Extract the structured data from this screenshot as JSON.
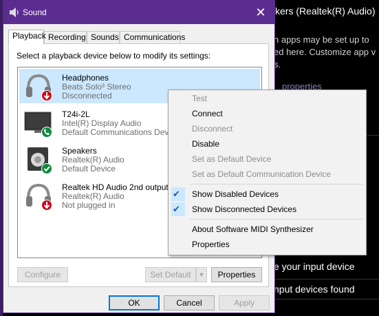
{
  "background_window": {
    "title": "kers (Realtek(R) Audio)",
    "text_lines": [
      "n apps may be set up to",
      "ed here. Customize app v",
      "s."
    ],
    "link": "properties",
    "input_device_text": "e your input device",
    "no_input_text": "nput devices found",
    "bottom_text": "..."
  },
  "dialog": {
    "title": "Sound",
    "close_label": "✕",
    "tabs": [
      "Playback",
      "Recording",
      "Sounds",
      "Communications"
    ],
    "instruction": "Select a playback device below to modify its settings:",
    "devices": [
      {
        "name": "Headphones",
        "line1": "Beats Solo³ Stereo",
        "line2": "Disconnected",
        "status": "disconnected",
        "icon": "headphones-icon"
      },
      {
        "name": "T24i-2L",
        "line1": "Intel(R) Display Audio",
        "line2": "Default Communications Device",
        "status": "default-communications",
        "icon": "monitor-icon"
      },
      {
        "name": "Speakers",
        "line1": "Realtek(R) Audio",
        "line2": "Default Device",
        "status": "default",
        "icon": "speaker-icon"
      },
      {
        "name": "Realtek HD Audio 2nd output",
        "line1": "Realtek(R) Audio",
        "line2": "Not plugged in",
        "status": "not-plugged-in",
        "icon": "headphones-icon"
      }
    ],
    "buttons": {
      "configure": "Configure",
      "set_default": "Set Default",
      "properties": "Properties",
      "ok": "OK",
      "cancel": "Cancel",
      "apply": "Apply"
    }
  },
  "context_menu": {
    "items": [
      {
        "label": "Test",
        "enabled": false
      },
      {
        "label": "Connect",
        "enabled": true
      },
      {
        "label": "Disconnect",
        "enabled": false
      },
      {
        "label": "Disable",
        "enabled": true
      },
      {
        "label": "Set as Default Device",
        "enabled": false
      },
      {
        "label": "Set as Default Communication Device",
        "enabled": false
      },
      {
        "label": "Show Disabled Devices",
        "enabled": true,
        "checked": true
      },
      {
        "label": "Show Disconnected Devices",
        "enabled": true,
        "checked": true
      },
      {
        "label": "About Software MIDI Synthesizer",
        "enabled": true
      },
      {
        "label": "Properties",
        "enabled": true
      }
    ]
  },
  "colors": {
    "titlebar": "#5c2d91",
    "selection": "#cce8ff",
    "disconnected_badge": "#d0021b",
    "default_badge": "#10893e"
  }
}
